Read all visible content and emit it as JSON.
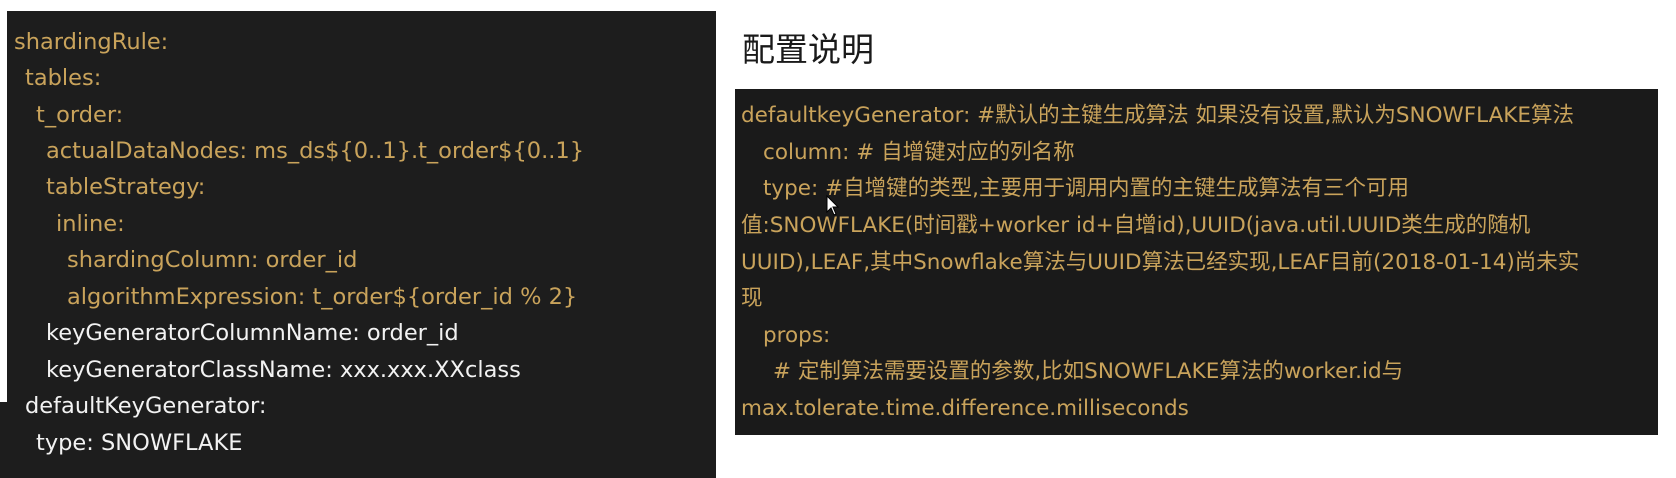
{
  "colors": {
    "key": "#c9a35b",
    "white": "#f2f2f2",
    "panel": "#1d1d1d"
  },
  "left_code": [
    {
      "text": "shardingRule:",
      "tone": "key"
    },
    {
      "text": "tables:",
      "tone": "key"
    },
    {
      "text": "t_order:",
      "tone": "key"
    },
    {
      "text": "actualDataNodes: ms_ds${0..1}.t_order${0..1}",
      "tone": "key"
    },
    {
      "text": "tableStrategy:",
      "tone": "key"
    },
    {
      "text": "inline:",
      "tone": "key"
    },
    {
      "text": "shardingColumn: order_id",
      "tone": "key"
    },
    {
      "text": "algorithmExpression: t_order${order_id % 2}",
      "tone": "key"
    },
    {
      "text": "keyGeneratorColumnName: order_id",
      "tone": "white"
    },
    {
      "text": "keyGeneratorClassName: xxx.xxx.XXclass",
      "tone": "white"
    },
    {
      "text": "defaultKeyGenerator:",
      "tone": "white"
    },
    {
      "text": "type: SNOWFLAKE",
      "tone": "white"
    }
  ],
  "right": {
    "title": "配置说明",
    "lines": [
      "defaultkeyGenerator: #默认的主键生成算法 如果没有设置,默认为SNOWFLAKE算法",
      "column: # 自增键对应的列名称",
      "type: #自增键的类型,主要用于调用内置的主键生成算法有三个可用",
      "值:SNOWFLAKE(时间戳+worker id+自增id),UUID(java.util.UUID类生成的随机",
      "UUID),LEAF,其中Snowflake算法与UUID算法已经实现,LEAF目前(2018-01-14)尚未实",
      "现",
      "props:",
      "# 定制算法需要设置的参数,比如SNOWFLAKE算法的worker.id与",
      "max.tolerate.time.difference.milliseconds"
    ]
  }
}
